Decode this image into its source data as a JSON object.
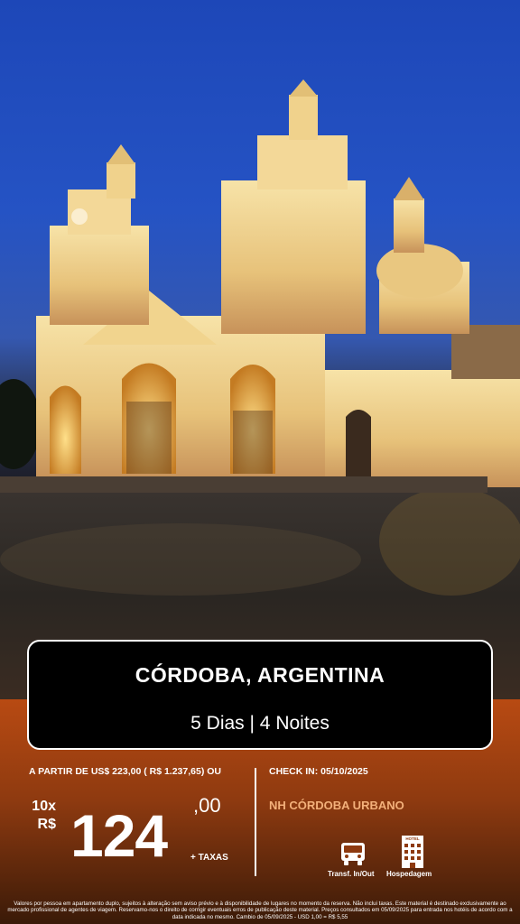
{
  "destination": {
    "title": "CÓRDOBA, ARGENTINA",
    "duration": "5 Dias | 4 Noites"
  },
  "pricing": {
    "from_text": "A PARTIR DE US$ 223,00 ( R$ 1.237,65) OU",
    "installments": "10x",
    "currency": "R$",
    "amount": "124",
    "cents": ",00",
    "taxes": "+ TAXAS"
  },
  "details": {
    "checkin": "CHECK IN: 05/10/2025",
    "hotel": "NH CÓRDOBA URBANO",
    "hotel_sign": "HOTEL",
    "services": [
      {
        "label": "Transf. In/Out",
        "icon": "bus-icon"
      },
      {
        "label": "Hospedagem",
        "icon": "hotel-icon"
      }
    ]
  },
  "disclaimer": "Valores por pessoa em apartamento duplo, sujeitos à alteração sem aviso prévio e à disponibilidade de lugares no momento da reserva. Não inclui taxas. Este material é destinado exclusivamente ao mercado profissional de agentes de viagem. Reservamo-nos o direito de corrigir eventuais erros de publicação deste material. Preços consultados em 05/09/2025 para entrada nos hotéis de acordo com a data indicada no mesmo. Cambio de 05/09/2025 - USD 1,00 = R$ 5,55",
  "colors": {
    "sky": "#2553c4",
    "banner_bg": "#000000",
    "panel_top": "#b84a12",
    "hotel_accent": "#f3b07a"
  }
}
